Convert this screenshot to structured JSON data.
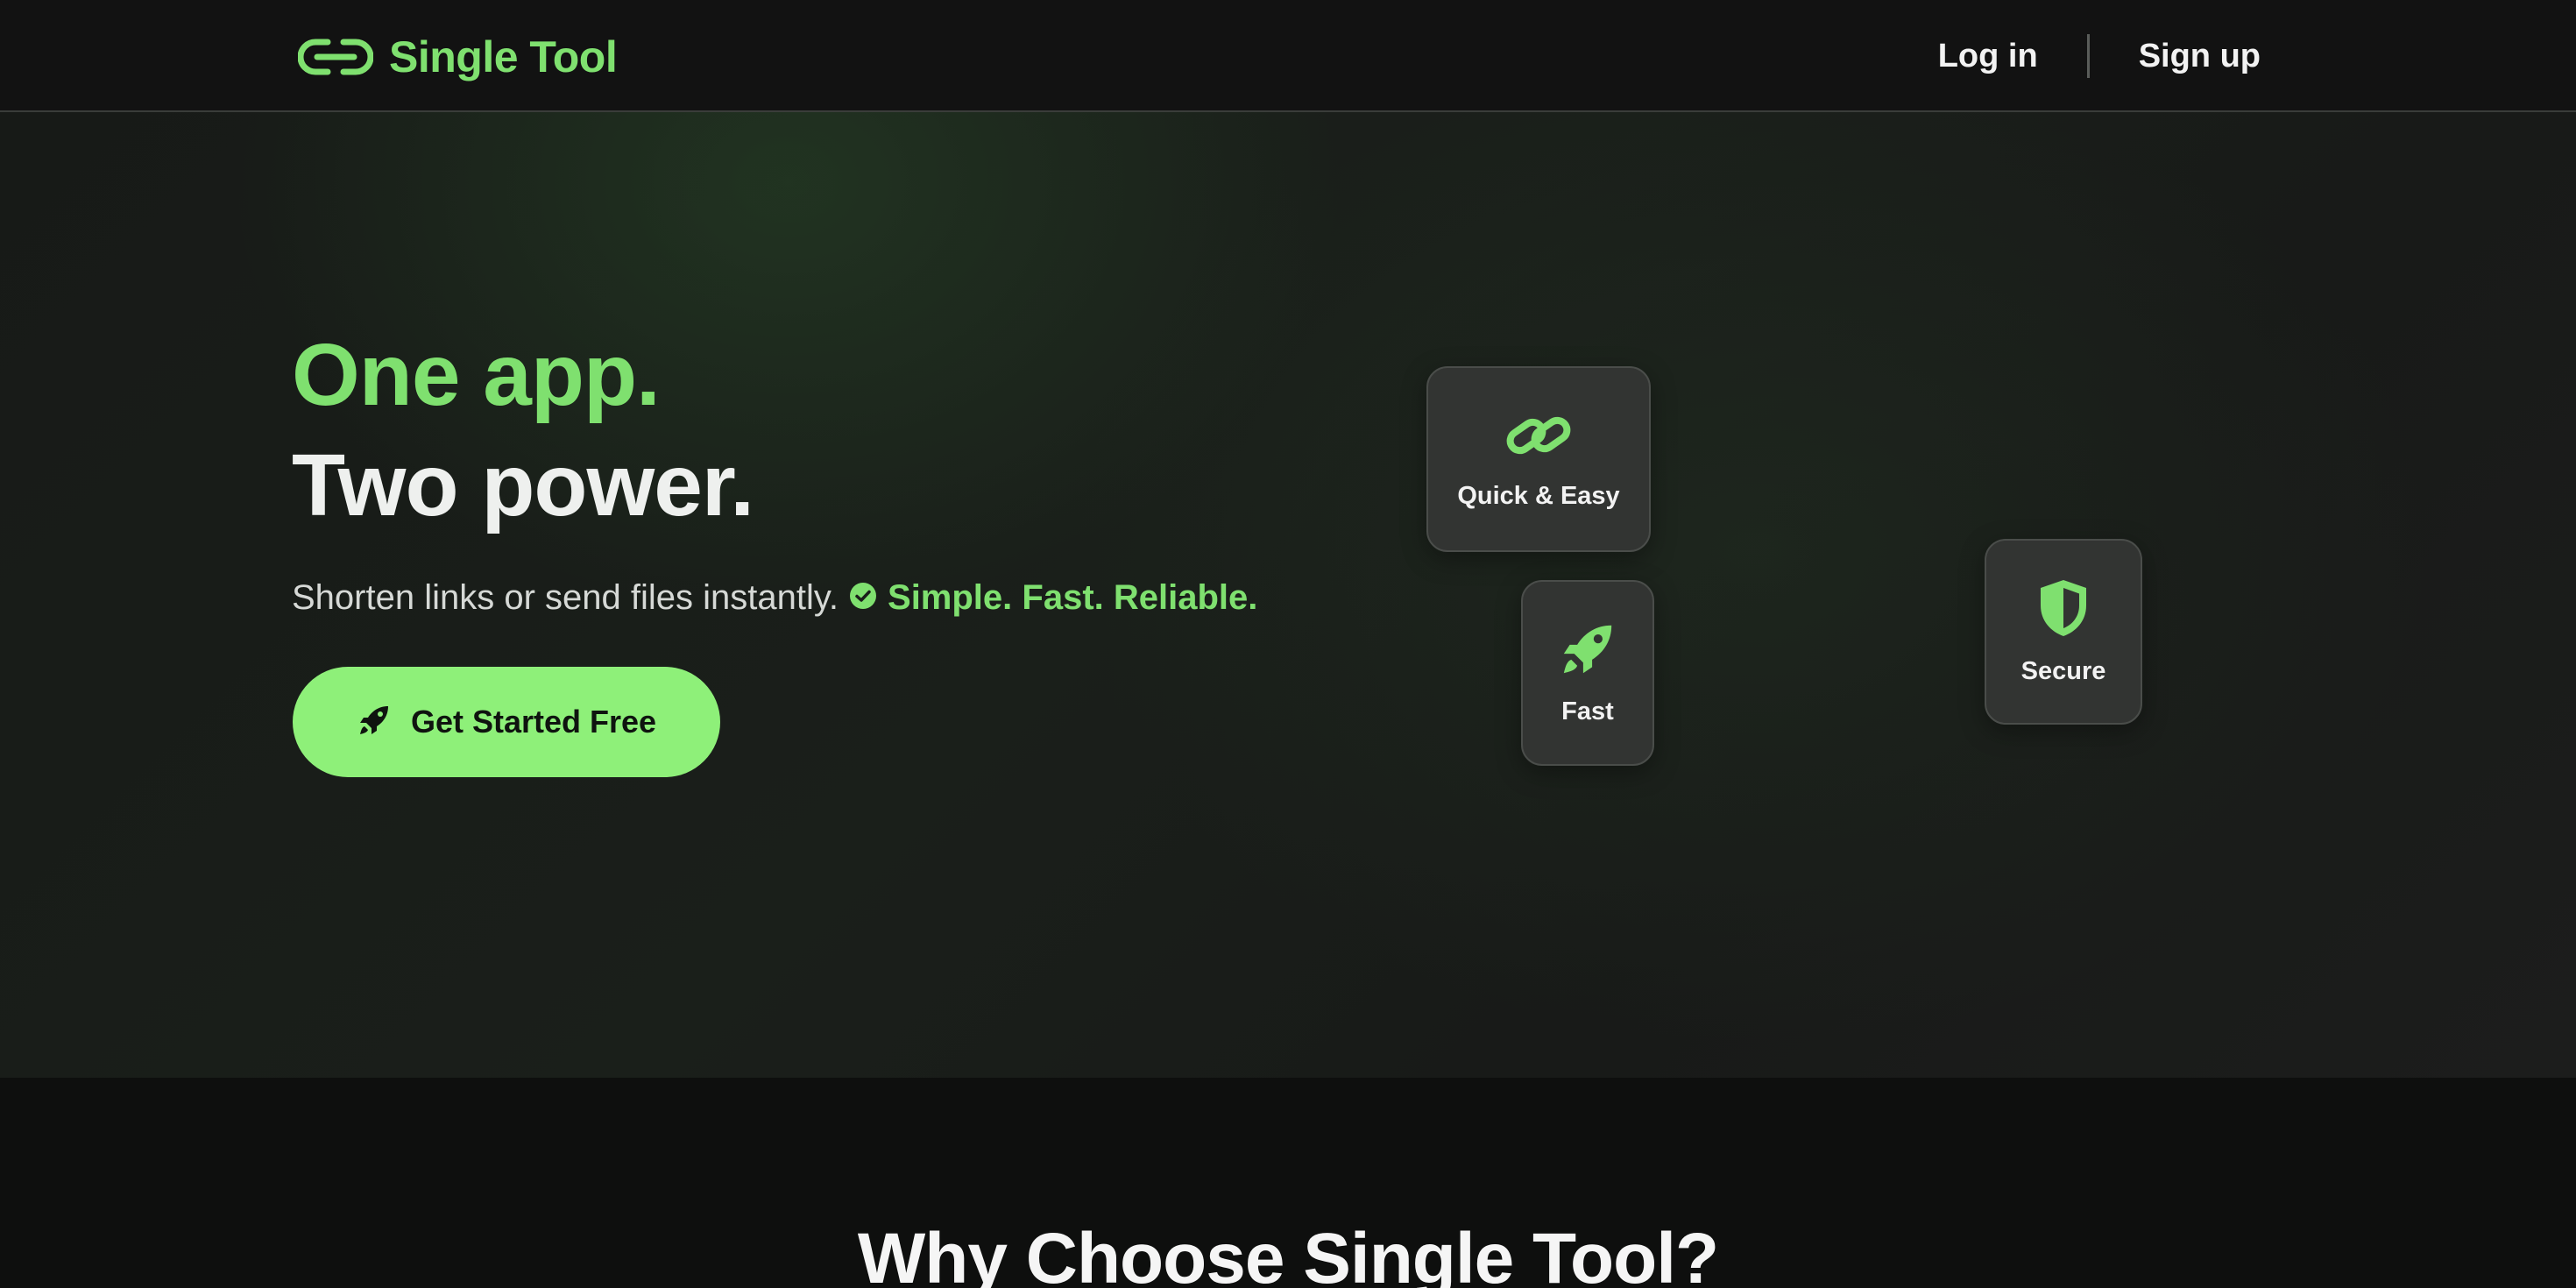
{
  "header": {
    "brand_name": "Single Tool",
    "login_label": "Log in",
    "signup_label": "Sign up"
  },
  "hero": {
    "headline_line1": "One app.",
    "headline_line2": "Two power.",
    "tagline": "Shorten links or send files instantly.",
    "tagline_accent": "Simple. Fast. Reliable.",
    "cta_label": "Get Started Free"
  },
  "features": {
    "quick_label": "Quick & Easy",
    "fast_label": "Fast",
    "secure_label": "Secure"
  },
  "section": {
    "title": "Why Choose Single Tool?"
  },
  "icons": {
    "brand": "link-icon",
    "check": "check-circle-icon",
    "cta": "rocket-icon",
    "quick": "chain-link-icon",
    "fast": "rocket-icon",
    "secure": "shield-icon"
  },
  "colors": {
    "accent": "#7fe06f",
    "cta_background": "#8ef079",
    "background": "#121212",
    "card": "#323432"
  }
}
